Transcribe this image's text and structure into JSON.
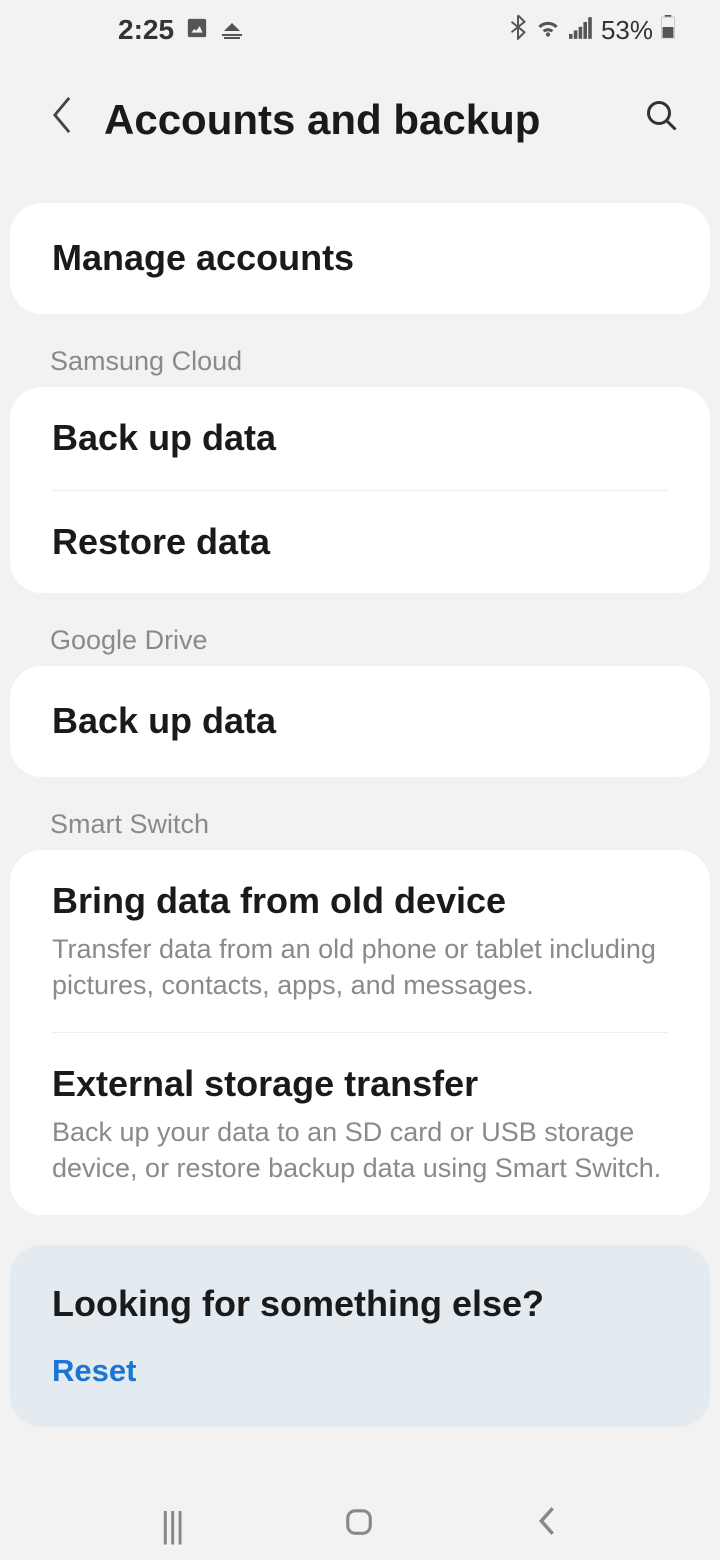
{
  "statusBar": {
    "time": "2:25",
    "battery": "53%"
  },
  "header": {
    "title": "Accounts and backup"
  },
  "sections": {
    "manageAccounts": "Manage accounts",
    "samsungCloud": {
      "header": "Samsung Cloud",
      "backup": "Back up data",
      "restore": "Restore data"
    },
    "googleDrive": {
      "header": "Google Drive",
      "backup": "Back up data"
    },
    "smartSwitch": {
      "header": "Smart Switch",
      "bring": {
        "title": "Bring data from old device",
        "subtitle": "Transfer data from an old phone or tablet including pictures, contacts, apps, and messages."
      },
      "external": {
        "title": "External storage transfer",
        "subtitle": "Back up your data to an SD card or USB storage device, or restore backup data using Smart Switch."
      }
    }
  },
  "footer": {
    "lookingTitle": "Looking for something else?",
    "reset": "Reset"
  }
}
